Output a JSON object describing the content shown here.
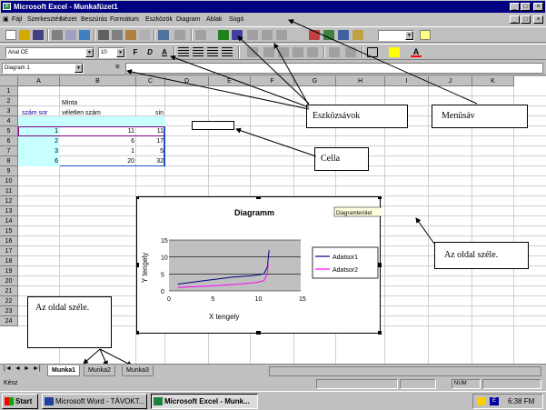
{
  "window": {
    "title": "Microsoft Excel - Munkafüzet1",
    "icon": "excel-icon"
  },
  "menu": [
    "Fájl",
    "Szerkesztés",
    "Nézet",
    "Beszúrás",
    "Formátum",
    "Eszközök",
    "Diagram",
    "Ablak",
    "Súgó"
  ],
  "toolbar": {
    "font_name": "Arial CE",
    "font_size": "10",
    "zoom": ""
  },
  "formula": {
    "namebox": "Diagram 1",
    "equals": "="
  },
  "columns": [
    "A",
    "B",
    "C",
    "D",
    "E",
    "F",
    "G",
    "H",
    "I",
    "J",
    "K"
  ],
  "rows": [
    "1",
    "2",
    "3",
    "4",
    "5",
    "6",
    "7",
    "8",
    "9",
    "10",
    "11",
    "12",
    "13",
    "14",
    "15",
    "16",
    "17",
    "18",
    "19",
    "20",
    "21",
    "22",
    "23",
    "24"
  ],
  "cells": {
    "b2": "Minta",
    "a3": "szám sor",
    "b3": "véletlen szám",
    "c3": "sin",
    "a4": "1",
    "b4": "11",
    "c4": "11",
    "a5": "2",
    "b5": "6",
    "c5": "17",
    "a6": "3",
    "b6": "1",
    "c6": "5",
    "a7": "6",
    "b7": "20",
    "c7": "32"
  },
  "chart_data": {
    "type": "line",
    "title": "Diagramm",
    "xlabel": "X tengely",
    "ylabel": "Y tengely",
    "xlim": [
      0,
      15
    ],
    "ylim": [
      0,
      15
    ],
    "xticks": [
      "0",
      "5",
      "10",
      "15"
    ],
    "yticks": [
      "0",
      "5",
      "10",
      "15"
    ],
    "tooltip": "Diagramterület",
    "series": [
      {
        "name": "Adatsor1",
        "color": "#000080",
        "x": [
          1,
          4,
          7,
          9.5,
          10.8,
          11.2,
          11.4
        ],
        "y": [
          2,
          3,
          4,
          4.5,
          5,
          7,
          12
        ]
      },
      {
        "name": "Adatsor2",
        "color": "#ff00ff",
        "x": [
          1,
          5,
          8,
          10,
          10.8,
          11.2,
          11.3
        ],
        "y": [
          1,
          1.5,
          2,
          2.5,
          3,
          5,
          8
        ]
      }
    ],
    "legend": "right"
  },
  "callouts": {
    "eszkoz": "Eszközsávok",
    "menusav": "Menüsáv",
    "cella": "Cella",
    "oldal_right": "Az oldal széle.",
    "oldal_left": "Az oldal széle."
  },
  "sheet_tabs": [
    "Munka1",
    "Munka2",
    "Munka3"
  ],
  "status": {
    "left": "Kész",
    "num": "NUM"
  },
  "taskbar": {
    "start": "Start",
    "items": [
      "Microsoft Word - TÁVOKT...",
      "Microsoft Excel - Munk..."
    ],
    "clock": "6:38 FM"
  }
}
